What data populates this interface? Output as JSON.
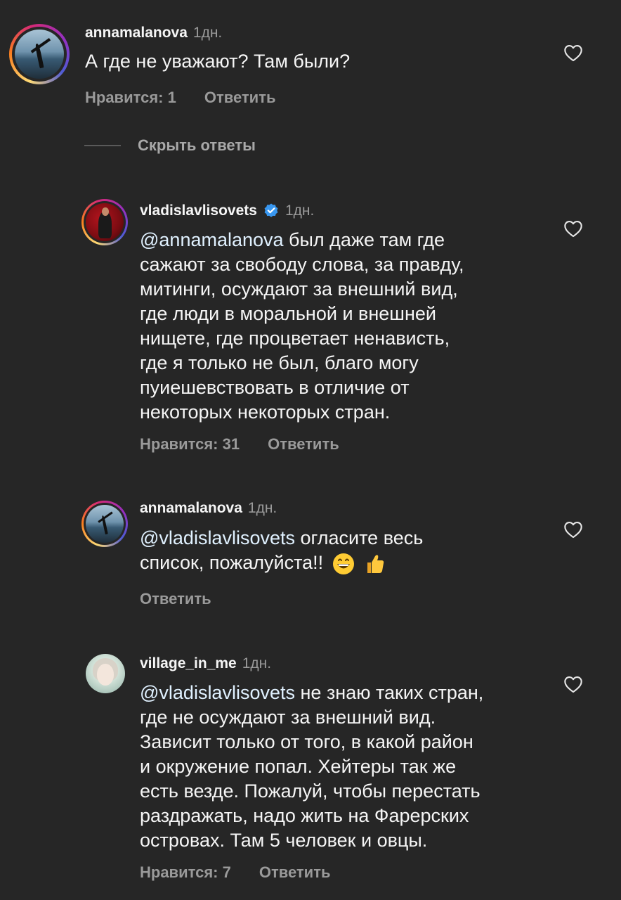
{
  "comments": [
    {
      "username": "annamalanova",
      "time": "1дн.",
      "text": "А где не уважают? Там были?",
      "likes": "Нравится: 1",
      "reply": "Ответить"
    },
    {
      "username": "vladislavlisovets",
      "time": "1дн.",
      "mention": "@annamalanova",
      "lines": [
        " был даже там где",
        "сажают за свободу слова, за правду,",
        "митинги, осуждают за внешний вид,",
        "где люди в моральной и внешней",
        "нищете, где процветает ненависть,",
        "где я только не был, благо могу",
        "пуиешевствовать в отличие от",
        "некоторых некоторых стран."
      ],
      "likes": "Нравится: 31",
      "reply": "Ответить"
    },
    {
      "username": "annamalanova",
      "time": "1дн.",
      "mention": "@vladislavlisovets",
      "lines": [
        " огласите весь",
        "список, пожалуйста!!"
      ],
      "reply": "Ответить"
    },
    {
      "username": "village_in_me",
      "time": "1дн.",
      "mention": "@vladislavlisovets",
      "lines": [
        " не знаю таких стран,",
        "где не осуждают за внешний вид.",
        "Зависит только от того, в какой район",
        "и окружение попал. Хейтеры так же",
        "есть везде. Пожалуй, чтобы перестать",
        "раздражать, надо жить на Фарерских",
        "островах. Там 5 человек и овцы."
      ],
      "likes": "Нравится: 7",
      "reply": "Ответить"
    }
  ],
  "hide_replies": "Скрыть ответы",
  "icons": {
    "like": "heart-outline-icon",
    "verified": "verified-badge-icon",
    "emoji_1": "grinning-face-emoji",
    "emoji_2": "thumbs-up-emoji"
  },
  "colors": {
    "background": "#262626",
    "text": "#f5f5f5",
    "secondary": "#9a9a9a",
    "mention": "#e0f1ff",
    "verified": "#3897f0"
  }
}
